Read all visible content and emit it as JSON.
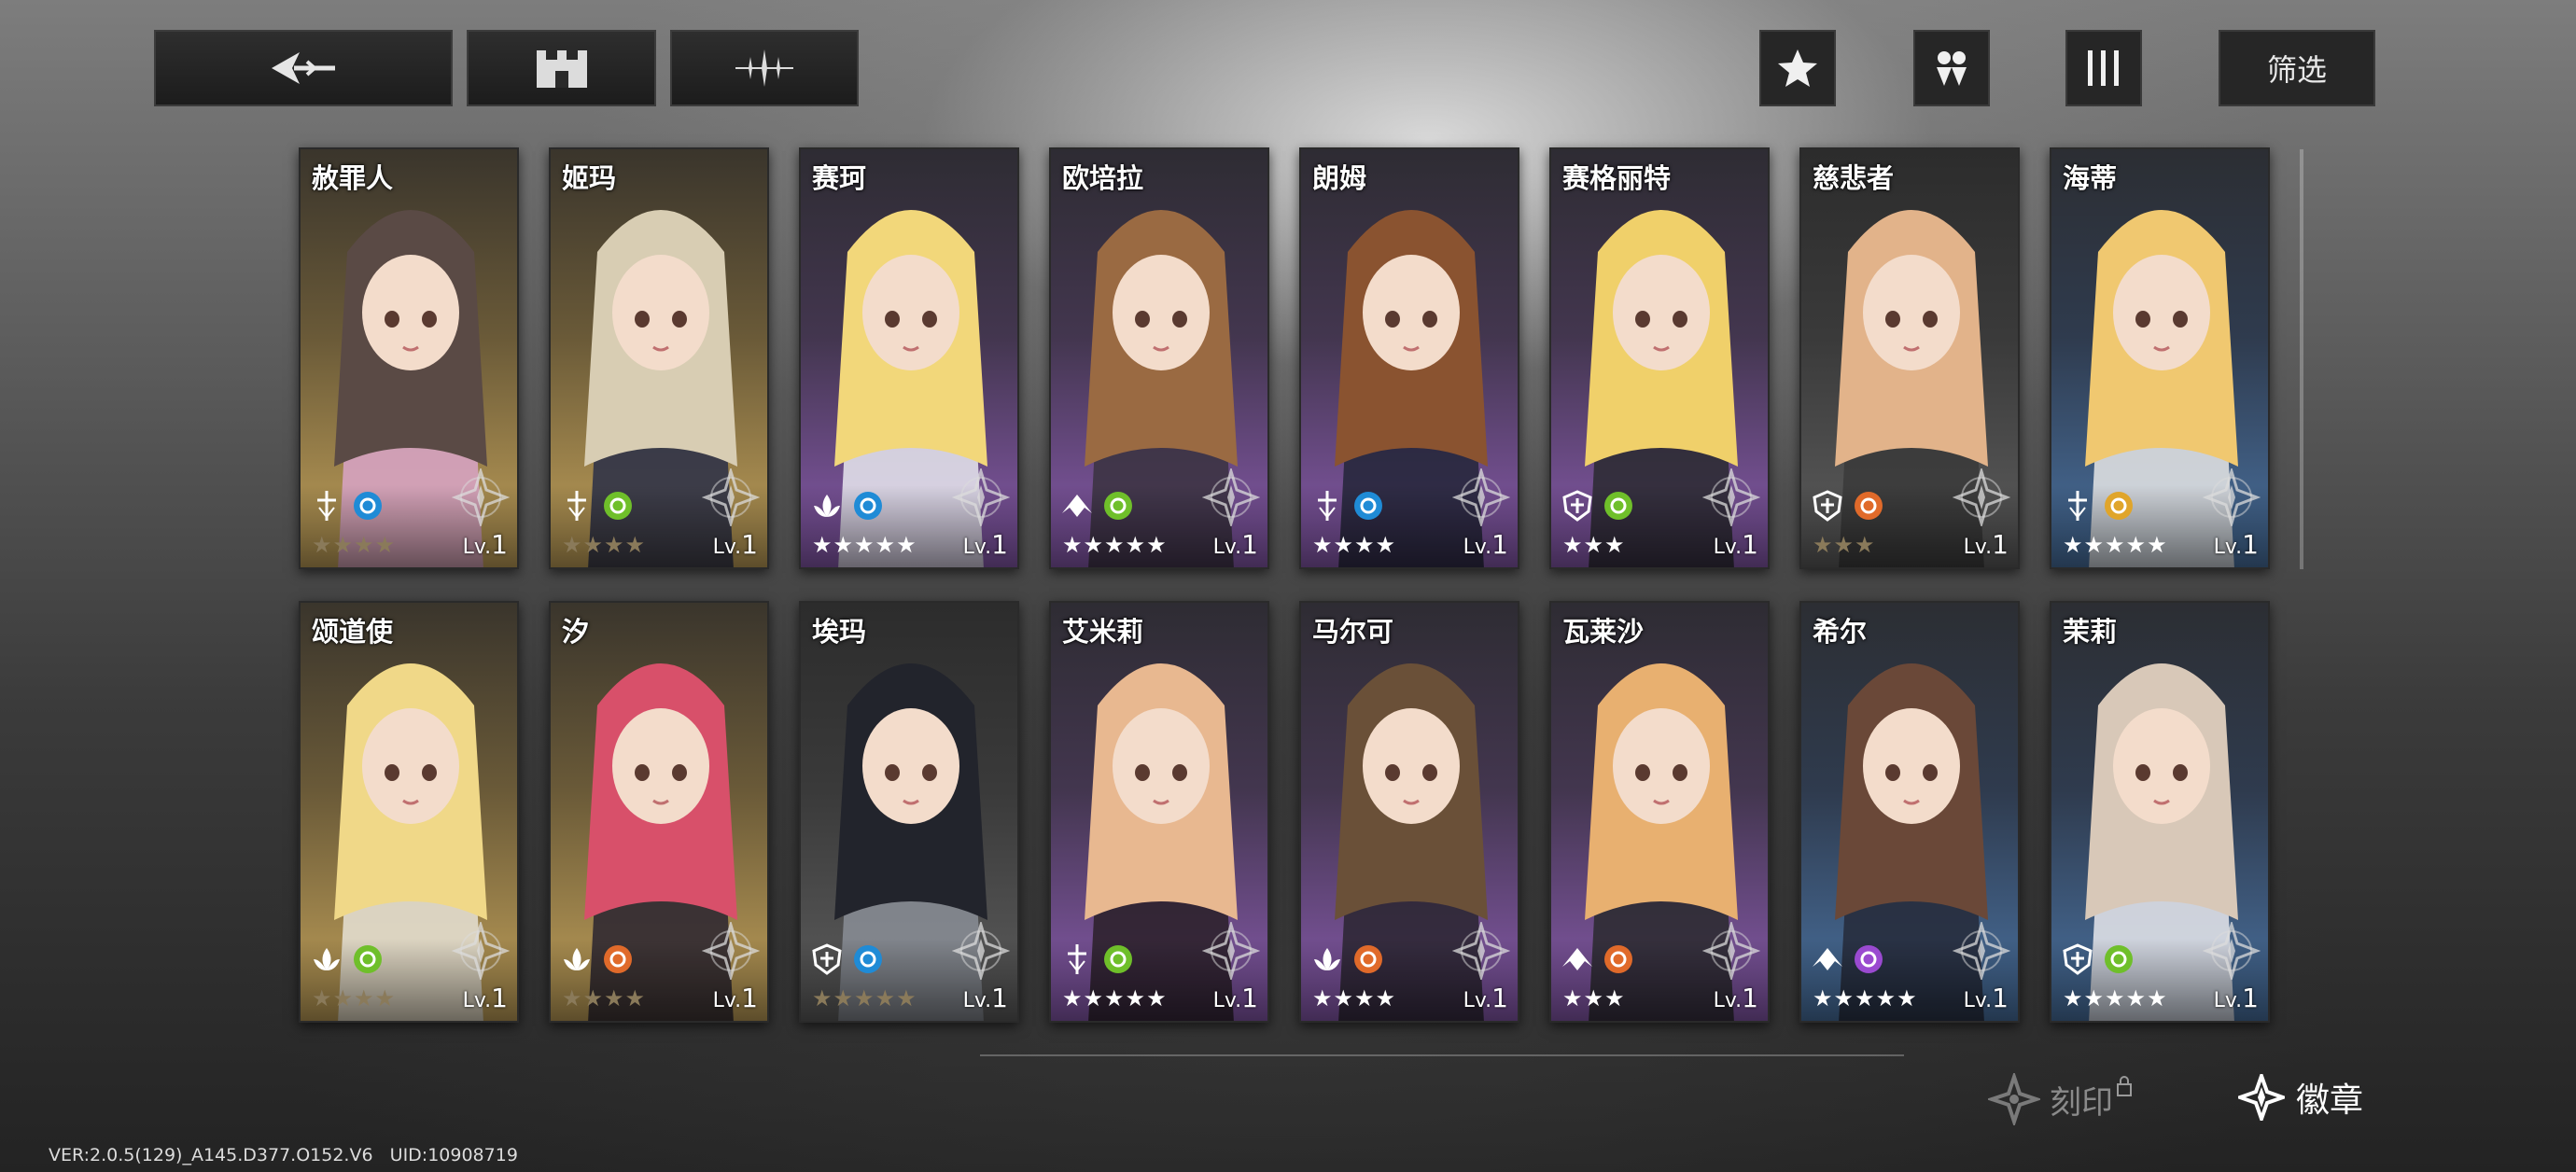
{
  "topbar": {
    "filter_label": "筛选"
  },
  "characters": [
    {
      "name": "赦罪人",
      "level": "1",
      "stars": 4,
      "stars_total": 4,
      "bg": "gold",
      "class_icon": "cross-sword",
      "element": "water",
      "element_color": "#1f8bd6",
      "hair": "#5a4a45",
      "hood": "#d9a4c8"
    },
    {
      "name": "姬玛",
      "level": "1",
      "stars": 4,
      "stars_total": 4,
      "bg": "gold",
      "class_icon": "cross-sword",
      "element": "nature",
      "element_color": "#6fbf2a",
      "hair": "#d8cdb3",
      "hood": "#2a2f48"
    },
    {
      "name": "赛珂",
      "level": "1",
      "stars": 5,
      "stars_total": 5,
      "bg": "purple",
      "class_icon": "lotus",
      "element": "water",
      "element_color": "#1f8bd6",
      "hair": "#f2d77a",
      "hood": "#e8e8ee"
    },
    {
      "name": "欧培拉",
      "level": "1",
      "stars": 5,
      "stars_total": 5,
      "bg": "purple",
      "class_icon": "wing",
      "element": "nature",
      "element_color": "#6fbf2a",
      "hair": "#9a6a42",
      "hood": "#3a3340"
    },
    {
      "name": "朗姆",
      "level": "1",
      "stars": 4,
      "stars_total": 4,
      "bg": "purple",
      "class_icon": "cross-sword",
      "element": "water",
      "element_color": "#1f8bd6",
      "hair": "#8a5330",
      "hood": "#232638"
    },
    {
      "name": "赛格丽特",
      "level": "1",
      "stars": 3,
      "stars_total": 3,
      "bg": "purple",
      "class_icon": "shield",
      "element": "nature",
      "element_color": "#6fbf2a",
      "hair": "#f0d06a",
      "hood": "#2a2a30"
    },
    {
      "name": "慈悲者",
      "level": "1",
      "stars": 3,
      "stars_total": 3,
      "bg": "gray",
      "class_icon": "shield",
      "element": "fire",
      "element_color": "#e06a2a",
      "hair": "#e2b38a",
      "hood": "#3a3a3a"
    },
    {
      "name": "海蒂",
      "level": "1",
      "stars": 5,
      "stars_total": 5,
      "bg": "blue",
      "class_icon": "cross-sword",
      "element": "sun",
      "element_color": "#e0a52a",
      "hair": "#f0c870",
      "hood": "#e6e6e6"
    },
    {
      "name": "颂道使",
      "level": "1",
      "stars": 4,
      "stars_total": 4,
      "bg": "gold",
      "class_icon": "lotus",
      "element": "nature",
      "element_color": "#6fbf2a",
      "hair": "#f0d888",
      "hood": "#e6e2d6"
    },
    {
      "name": "汐",
      "level": "1",
      "stars": 4,
      "stars_total": 4,
      "bg": "gold",
      "class_icon": "lotus",
      "element": "fire",
      "element_color": "#e06a2a",
      "hair": "#d8506a",
      "hood": "#2a2430"
    },
    {
      "name": "埃玛",
      "level": "1",
      "stars": 5,
      "stars_total": 5,
      "bg": "gray",
      "class_icon": "shield",
      "element": "water",
      "element_color": "#1f8bd6",
      "hair": "#22242c",
      "hood": "#8a8e96"
    },
    {
      "name": "艾米莉",
      "level": "1",
      "stars": 5,
      "stars_total": 5,
      "bg": "purple",
      "class_icon": "cross-sword",
      "element": "nature",
      "element_color": "#6fbf2a",
      "hair": "#e8b890",
      "hood": "#2a2028"
    },
    {
      "name": "马尔可",
      "level": "1",
      "stars": 4,
      "stars_total": 4,
      "bg": "purple",
      "class_icon": "lotus",
      "element": "fire",
      "element_color": "#e06a2a",
      "hair": "#6a5038",
      "hood": "#2a2630"
    },
    {
      "name": "瓦莱沙",
      "level": "1",
      "stars": 3,
      "stars_total": 3,
      "bg": "purple",
      "class_icon": "wing",
      "element": "fire",
      "element_color": "#e06a2a",
      "hair": "#e8b070",
      "hood": "#2a2a2e"
    },
    {
      "name": "希尔",
      "level": "1",
      "stars": 5,
      "stars_total": 5,
      "bg": "blue",
      "class_icon": "wing",
      "element": "dark",
      "element_color": "#9a4ad0",
      "hair": "#6a4838",
      "hood": "#262a3a"
    },
    {
      "name": "茉莉",
      "level": "1",
      "stars": 5,
      "stars_total": 5,
      "bg": "blue",
      "class_icon": "shield",
      "element": "nature",
      "element_color": "#6fbf2a",
      "hair": "#d8c8b8",
      "hood": "#e8e8ec"
    }
  ],
  "bottom": {
    "engrave_label": "刻印",
    "badge_label": "徽章",
    "version_text": "VER:2.0.5(129)_A145.D377.O152.V6   UID:10908719"
  },
  "colors": {
    "bg_gold": "#b89a4e",
    "bg_purple": "#7a4fa0",
    "bg_blue": "#3d5f88",
    "bg_gray": "#4a4a4a",
    "star_active": "#ffffff",
    "star_dim": "#8a7a5a"
  }
}
